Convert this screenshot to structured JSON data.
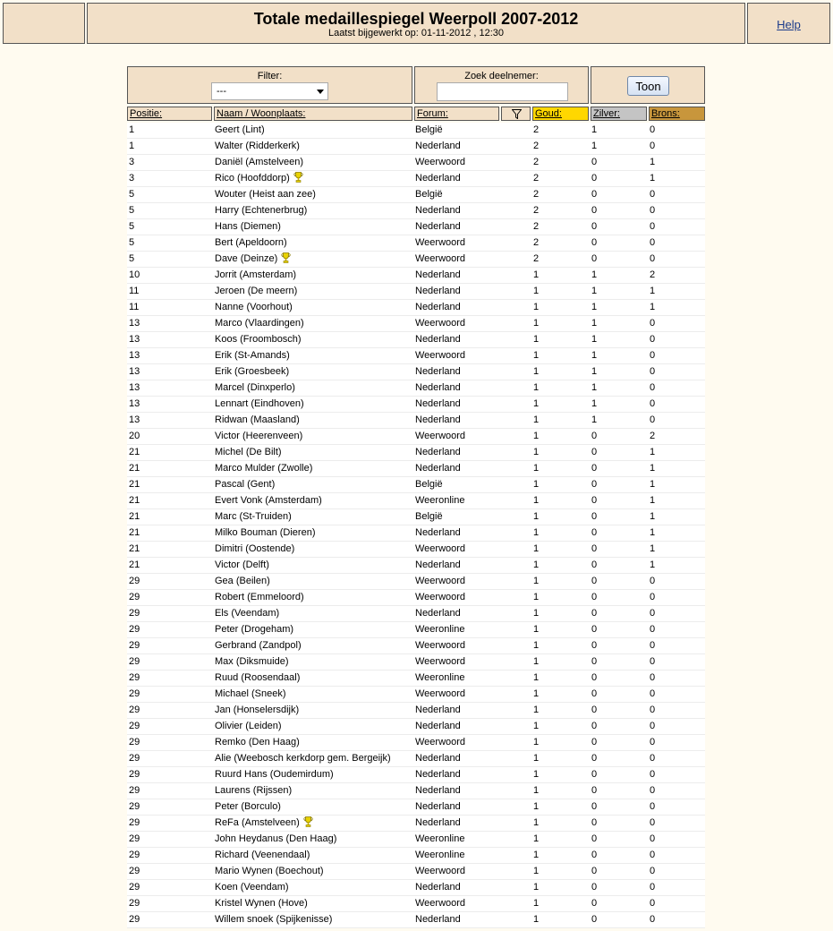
{
  "header": {
    "title": "Totale medaillespiegel Weerpoll 2007-2012",
    "subtitle": "Laatst bijgewerkt op: 01-11-2012 , 12:30",
    "help_label": "Help"
  },
  "controls": {
    "filter_label": "Filter:",
    "filter_value": "---",
    "search_label": "Zoek deelnemer:",
    "search_value": "",
    "button_label": "Toon"
  },
  "columns": {
    "positie": "Positie:",
    "naam": "Naam / Woonplaats:",
    "forum": "Forum:",
    "goud": "Goud:",
    "zilver": "Zilver:",
    "brons": "Brons:"
  },
  "colors": {
    "gold": "#ffd700",
    "silver": "#c4c4c4",
    "bronze": "#c8963c",
    "panel": "#f2e0c8"
  },
  "icons": {
    "trophy": "trophy-icon",
    "filter": "funnel-icon",
    "dropdown": "chevron-down-icon"
  },
  "rows": [
    {
      "pos": "1",
      "naam": "Geert (Lint)",
      "forum": "België",
      "goud": "2",
      "zilver": "1",
      "brons": "0",
      "trophy": false
    },
    {
      "pos": "1",
      "naam": "Walter (Ridderkerk)",
      "forum": "Nederland",
      "goud": "2",
      "zilver": "1",
      "brons": "0",
      "trophy": false
    },
    {
      "pos": "3",
      "naam": "Daniël (Amstelveen)",
      "forum": "Weerwoord",
      "goud": "2",
      "zilver": "0",
      "brons": "1",
      "trophy": false
    },
    {
      "pos": "3",
      "naam": "Rico (Hoofddorp)",
      "forum": "Nederland",
      "goud": "2",
      "zilver": "0",
      "brons": "1",
      "trophy": true
    },
    {
      "pos": "5",
      "naam": "Wouter (Heist aan zee)",
      "forum": "België",
      "goud": "2",
      "zilver": "0",
      "brons": "0",
      "trophy": false
    },
    {
      "pos": "5",
      "naam": "Harry (Echtenerbrug)",
      "forum": "Nederland",
      "goud": "2",
      "zilver": "0",
      "brons": "0",
      "trophy": false
    },
    {
      "pos": "5",
      "naam": "Hans (Diemen)",
      "forum": "Nederland",
      "goud": "2",
      "zilver": "0",
      "brons": "0",
      "trophy": false
    },
    {
      "pos": "5",
      "naam": "Bert (Apeldoorn)",
      "forum": "Weerwoord",
      "goud": "2",
      "zilver": "0",
      "brons": "0",
      "trophy": false
    },
    {
      "pos": "5",
      "naam": "Dave (Deinze)",
      "forum": "Weerwoord",
      "goud": "2",
      "zilver": "0",
      "brons": "0",
      "trophy": true
    },
    {
      "pos": "10",
      "naam": "Jorrit (Amsterdam)",
      "forum": "Nederland",
      "goud": "1",
      "zilver": "1",
      "brons": "2",
      "trophy": false
    },
    {
      "pos": "11",
      "naam": "Jeroen (De meern)",
      "forum": "Nederland",
      "goud": "1",
      "zilver": "1",
      "brons": "1",
      "trophy": false
    },
    {
      "pos": "11",
      "naam": "Nanne (Voorhout)",
      "forum": "Nederland",
      "goud": "1",
      "zilver": "1",
      "brons": "1",
      "trophy": false
    },
    {
      "pos": "13",
      "naam": "Marco (Vlaardingen)",
      "forum": "Weerwoord",
      "goud": "1",
      "zilver": "1",
      "brons": "0",
      "trophy": false
    },
    {
      "pos": "13",
      "naam": "Koos (Froombosch)",
      "forum": "Nederland",
      "goud": "1",
      "zilver": "1",
      "brons": "0",
      "trophy": false
    },
    {
      "pos": "13",
      "naam": "Erik (St-Amands)",
      "forum": "Weerwoord",
      "goud": "1",
      "zilver": "1",
      "brons": "0",
      "trophy": false
    },
    {
      "pos": "13",
      "naam": "Erik (Groesbeek)",
      "forum": "Nederland",
      "goud": "1",
      "zilver": "1",
      "brons": "0",
      "trophy": false
    },
    {
      "pos": "13",
      "naam": "Marcel (Dinxperlo)",
      "forum": "Nederland",
      "goud": "1",
      "zilver": "1",
      "brons": "0",
      "trophy": false
    },
    {
      "pos": "13",
      "naam": "Lennart (Eindhoven)",
      "forum": "Nederland",
      "goud": "1",
      "zilver": "1",
      "brons": "0",
      "trophy": false
    },
    {
      "pos": "13",
      "naam": "Ridwan (Maasland)",
      "forum": "Nederland",
      "goud": "1",
      "zilver": "1",
      "brons": "0",
      "trophy": false
    },
    {
      "pos": "20",
      "naam": "Victor (Heerenveen)",
      "forum": "Weerwoord",
      "goud": "1",
      "zilver": "0",
      "brons": "2",
      "trophy": false
    },
    {
      "pos": "21",
      "naam": "Michel (De Bilt)",
      "forum": "Nederland",
      "goud": "1",
      "zilver": "0",
      "brons": "1",
      "trophy": false
    },
    {
      "pos": "21",
      "naam": "Marco Mulder (Zwolle)",
      "forum": "Nederland",
      "goud": "1",
      "zilver": "0",
      "brons": "1",
      "trophy": false
    },
    {
      "pos": "21",
      "naam": "Pascal (Gent)",
      "forum": "België",
      "goud": "1",
      "zilver": "0",
      "brons": "1",
      "trophy": false
    },
    {
      "pos": "21",
      "naam": "Evert Vonk (Amsterdam)",
      "forum": "Weeronline",
      "goud": "1",
      "zilver": "0",
      "brons": "1",
      "trophy": false
    },
    {
      "pos": "21",
      "naam": "Marc (St-Truiden)",
      "forum": "België",
      "goud": "1",
      "zilver": "0",
      "brons": "1",
      "trophy": false
    },
    {
      "pos": "21",
      "naam": "Milko Bouman (Dieren)",
      "forum": "Nederland",
      "goud": "1",
      "zilver": "0",
      "brons": "1",
      "trophy": false
    },
    {
      "pos": "21",
      "naam": "Dimitri (Oostende)",
      "forum": "Weerwoord",
      "goud": "1",
      "zilver": "0",
      "brons": "1",
      "trophy": false
    },
    {
      "pos": "21",
      "naam": "Victor (Delft)",
      "forum": "Nederland",
      "goud": "1",
      "zilver": "0",
      "brons": "1",
      "trophy": false
    },
    {
      "pos": "29",
      "naam": "Gea (Beilen)",
      "forum": "Weerwoord",
      "goud": "1",
      "zilver": "0",
      "brons": "0",
      "trophy": false
    },
    {
      "pos": "29",
      "naam": "Robert (Emmeloord)",
      "forum": "Weerwoord",
      "goud": "1",
      "zilver": "0",
      "brons": "0",
      "trophy": false
    },
    {
      "pos": "29",
      "naam": "Els (Veendam)",
      "forum": "Nederland",
      "goud": "1",
      "zilver": "0",
      "brons": "0",
      "trophy": false
    },
    {
      "pos": "29",
      "naam": "Peter (Drogeham)",
      "forum": "Weeronline",
      "goud": "1",
      "zilver": "0",
      "brons": "0",
      "trophy": false
    },
    {
      "pos": "29",
      "naam": "Gerbrand (Zandpol)",
      "forum": "Weerwoord",
      "goud": "1",
      "zilver": "0",
      "brons": "0",
      "trophy": false
    },
    {
      "pos": "29",
      "naam": "Max (Diksmuide)",
      "forum": "Weerwoord",
      "goud": "1",
      "zilver": "0",
      "brons": "0",
      "trophy": false
    },
    {
      "pos": "29",
      "naam": "Ruud (Roosendaal)",
      "forum": "Weeronline",
      "goud": "1",
      "zilver": "0",
      "brons": "0",
      "trophy": false
    },
    {
      "pos": "29",
      "naam": "Michael (Sneek)",
      "forum": "Weerwoord",
      "goud": "1",
      "zilver": "0",
      "brons": "0",
      "trophy": false
    },
    {
      "pos": "29",
      "naam": "Jan (Honselersdijk)",
      "forum": "Nederland",
      "goud": "1",
      "zilver": "0",
      "brons": "0",
      "trophy": false
    },
    {
      "pos": "29",
      "naam": "Olivier (Leiden)",
      "forum": "Nederland",
      "goud": "1",
      "zilver": "0",
      "brons": "0",
      "trophy": false
    },
    {
      "pos": "29",
      "naam": "Remko (Den Haag)",
      "forum": "Weerwoord",
      "goud": "1",
      "zilver": "0",
      "brons": "0",
      "trophy": false
    },
    {
      "pos": "29",
      "naam": "Alie (Weebosch kerkdorp gem. Bergeijk)",
      "forum": "Nederland",
      "goud": "1",
      "zilver": "0",
      "brons": "0",
      "trophy": false
    },
    {
      "pos": "29",
      "naam": "Ruurd Hans (Oudemirdum)",
      "forum": "Nederland",
      "goud": "1",
      "zilver": "0",
      "brons": "0",
      "trophy": false
    },
    {
      "pos": "29",
      "naam": "Laurens (Rijssen)",
      "forum": "Nederland",
      "goud": "1",
      "zilver": "0",
      "brons": "0",
      "trophy": false
    },
    {
      "pos": "29",
      "naam": "Peter (Borculo)",
      "forum": "Nederland",
      "goud": "1",
      "zilver": "0",
      "brons": "0",
      "trophy": false
    },
    {
      "pos": "29",
      "naam": "ReFa (Amstelveen)",
      "forum": "Nederland",
      "goud": "1",
      "zilver": "0",
      "brons": "0",
      "trophy": true
    },
    {
      "pos": "29",
      "naam": "John Heydanus (Den Haag)",
      "forum": "Weeronline",
      "goud": "1",
      "zilver": "0",
      "brons": "0",
      "trophy": false
    },
    {
      "pos": "29",
      "naam": "Richard (Veenendaal)",
      "forum": "Weeronline",
      "goud": "1",
      "zilver": "0",
      "brons": "0",
      "trophy": false
    },
    {
      "pos": "29",
      "naam": "Mario Wynen (Boechout)",
      "forum": "Weerwoord",
      "goud": "1",
      "zilver": "0",
      "brons": "0",
      "trophy": false
    },
    {
      "pos": "29",
      "naam": "Koen (Veendam)",
      "forum": "Nederland",
      "goud": "1",
      "zilver": "0",
      "brons": "0",
      "trophy": false
    },
    {
      "pos": "29",
      "naam": "Kristel Wynen (Hove)",
      "forum": "Weerwoord",
      "goud": "1",
      "zilver": "0",
      "brons": "0",
      "trophy": false
    },
    {
      "pos": "29",
      "naam": "Willem snoek (Spijkenisse)",
      "forum": "Nederland",
      "goud": "1",
      "zilver": "0",
      "brons": "0",
      "trophy": false
    }
  ]
}
